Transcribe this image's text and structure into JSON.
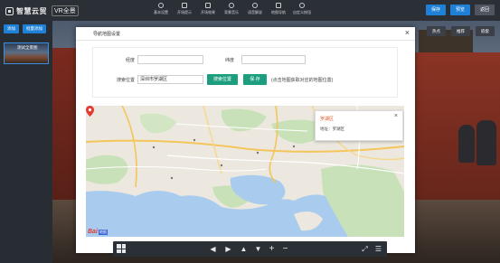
{
  "app": {
    "logo_text": "智慧云贸",
    "logo_badge": "VR全景"
  },
  "topnav": [
    {
      "label": "基本设置",
      "icon": "settings-icon"
    },
    {
      "label": "开场提示",
      "icon": "tip-icon"
    },
    {
      "label": "开场效果",
      "icon": "effect-icon"
    },
    {
      "label": "背景音乐",
      "icon": "music-icon"
    },
    {
      "label": "语音解说",
      "icon": "headphone-icon"
    },
    {
      "label": "地图导航",
      "icon": "map-icon"
    },
    {
      "label": "自定义按钮",
      "icon": "custom-button-icon"
    }
  ],
  "topbuttons": {
    "save": "保存",
    "preview": "预览",
    "back": "返回"
  },
  "leftpanel": {
    "btn_add": "添加",
    "btn_batch": "批量添加",
    "thumb_label": "测试全景图"
  },
  "pano_buttons": [
    "热点",
    "推荐",
    "嵌套"
  ],
  "modal": {
    "title": "导航地图设置",
    "close": "×",
    "form": {
      "longitude_label": "经度",
      "longitude_value": "",
      "latitude_label": "纬度",
      "latitude_value": "",
      "location_label": "搜索位置",
      "location_value": "深圳市罗湖区",
      "search_button": "搜索位置",
      "save_button": "保 存",
      "hint": "(点击地图获取对应的地图位置)"
    },
    "map": {
      "popup_title": "罗湖区",
      "popup_address": "地址：罗湖区",
      "popup_close": "×",
      "logo_text": "Bai",
      "logo_sub": "地图",
      "accent_marker": "#e33b2f"
    }
  },
  "bottombar": {
    "icons": [
      "grid-icon",
      "arrow-left-icon",
      "arrow-right-icon",
      "arrow-up-icon",
      "arrow-down-icon",
      "plus-icon",
      "minus-icon",
      "fullscreen-icon",
      "menu-icon"
    ]
  },
  "colors": {
    "accent_blue": "#1e80d6",
    "accent_green": "#1d9e7f",
    "popup_title": "#e0562b"
  }
}
